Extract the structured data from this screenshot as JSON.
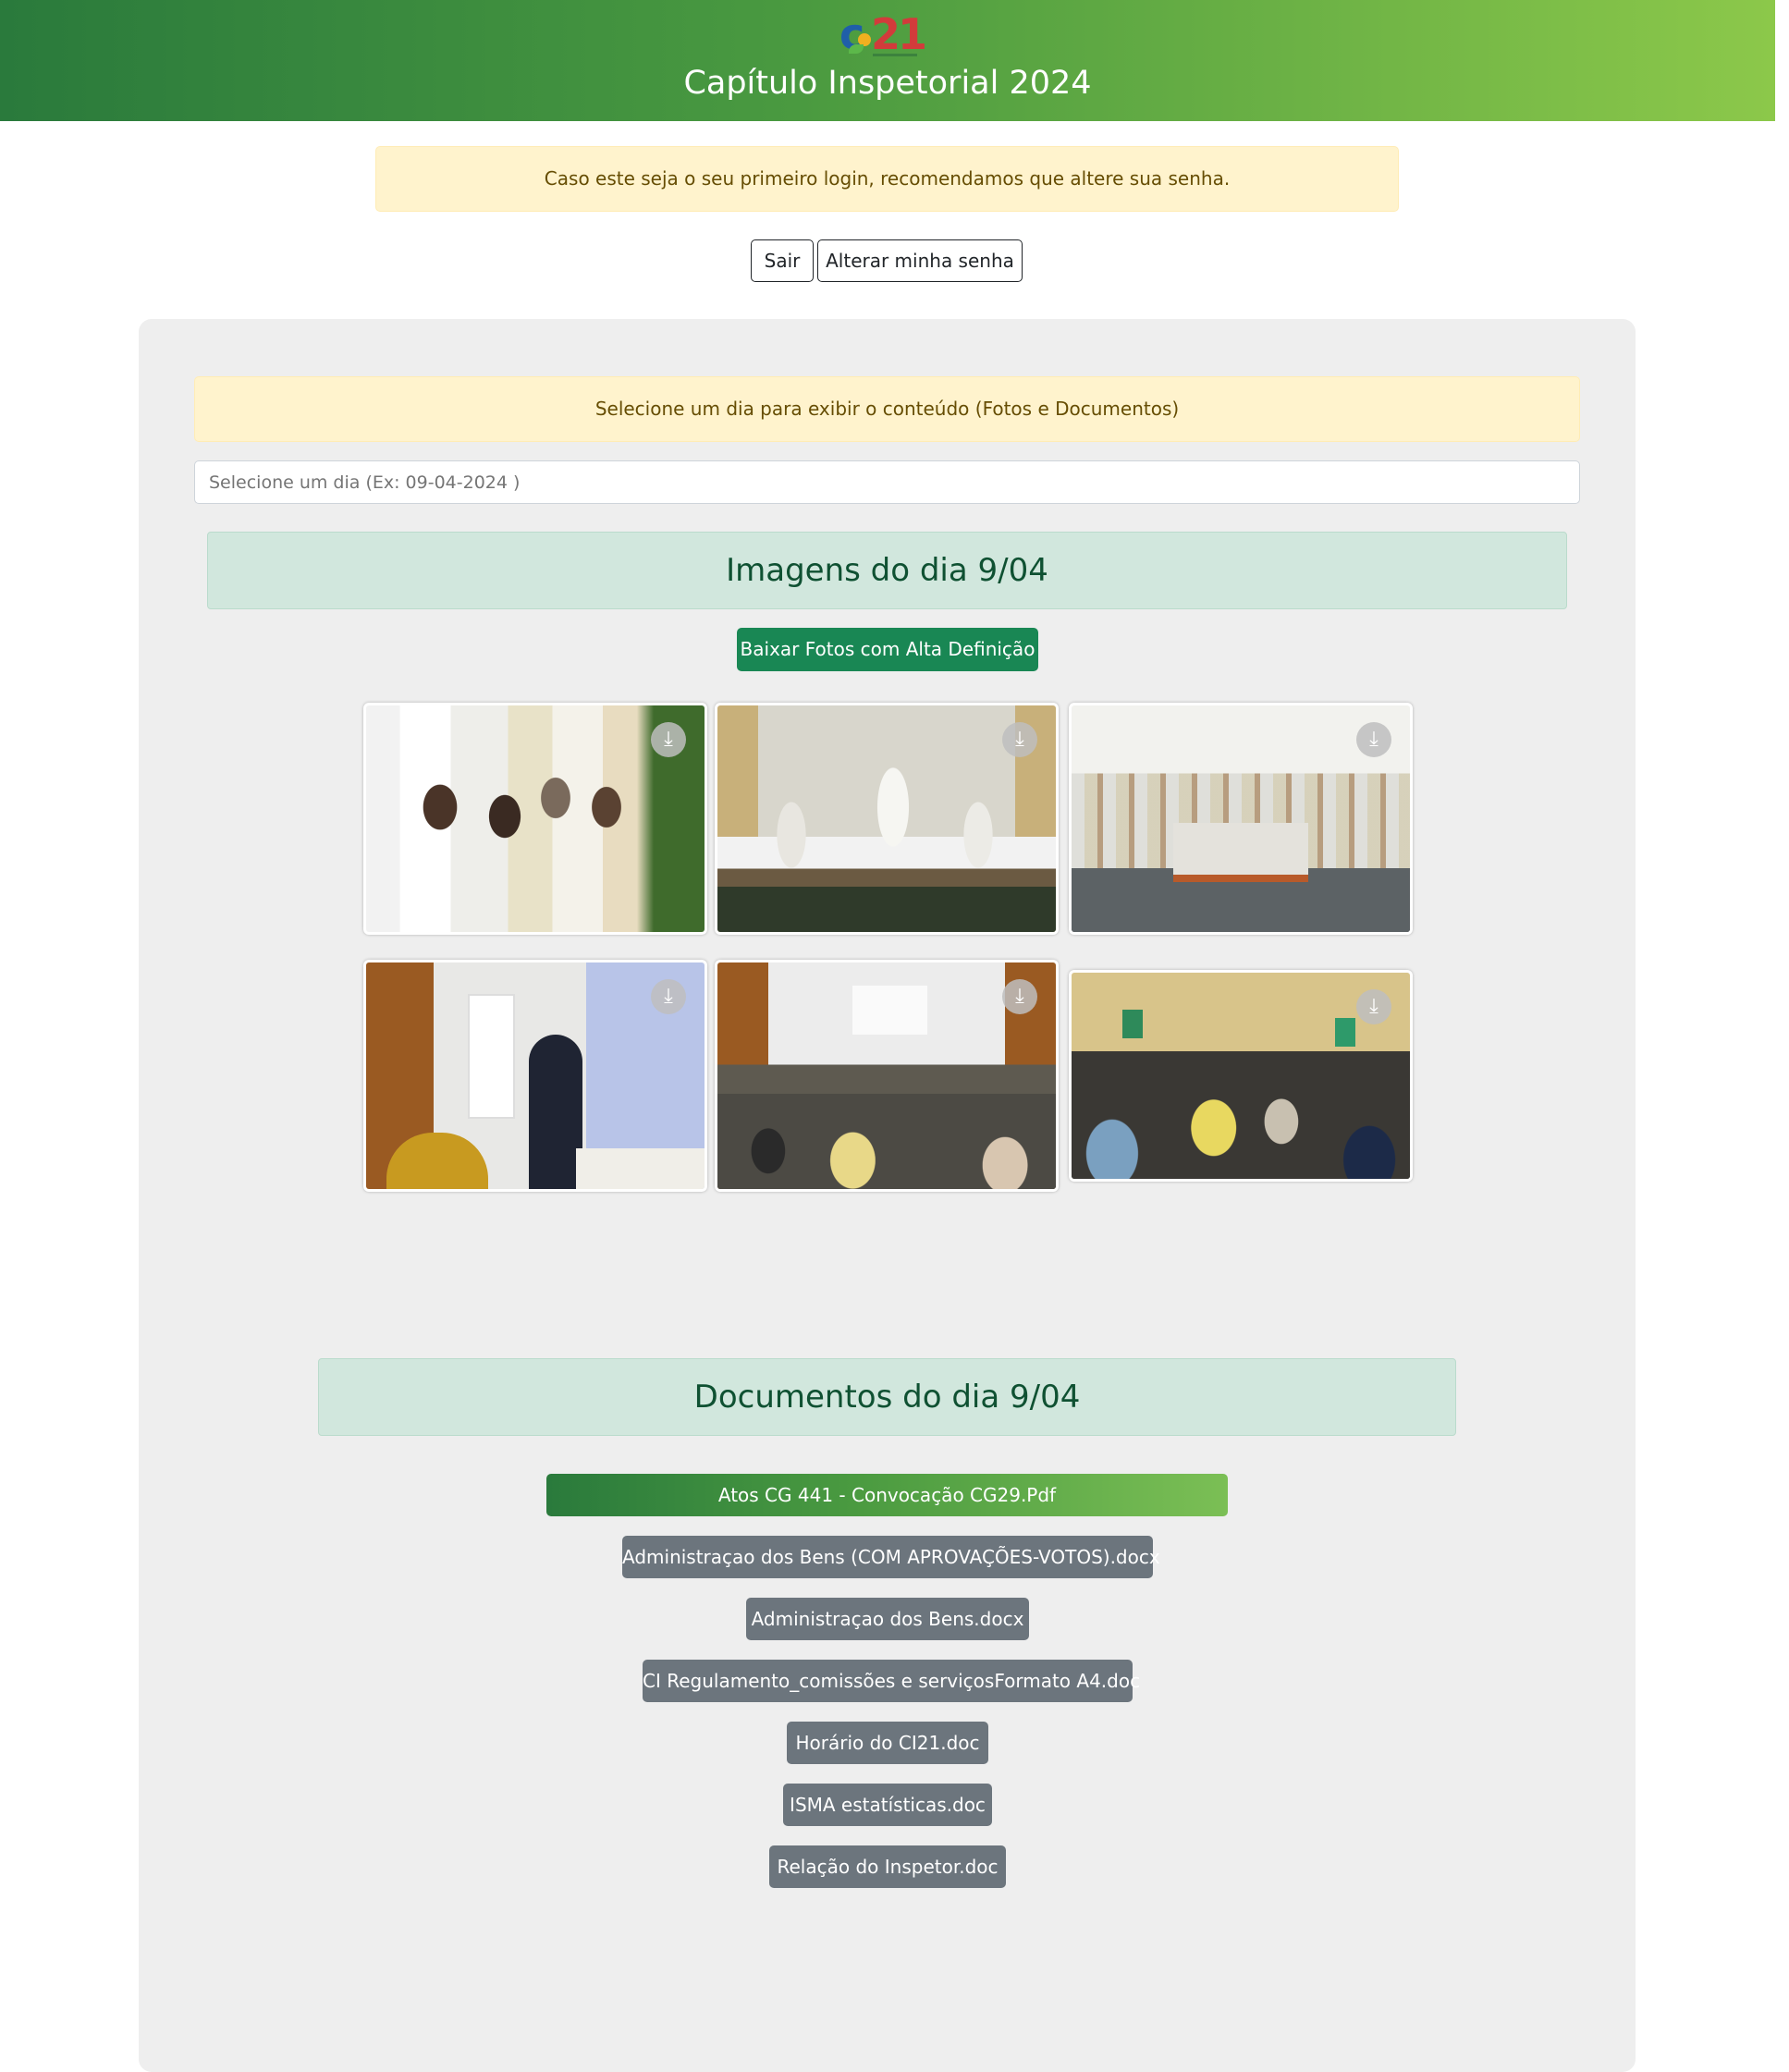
{
  "header": {
    "logo_text": "ci21",
    "title": "Capítulo Inspetorial 2024"
  },
  "notice": {
    "first_login": "Caso este seja o seu primeiro login, recomendamos que altere sua senha."
  },
  "actions": {
    "logout_label": "Sair",
    "change_password_label": "Alterar minha senha"
  },
  "content": {
    "select_day_alert": "Selecione um dia para exibir o conteúdo (Fotos e Documentos)",
    "date_input_placeholder": "Selecione um dia (Ex: 09-04-2024 )",
    "images_heading": "Imagens do dia 9/04",
    "download_hd_label": "Baixar Fotos com Alta Definição",
    "photos": [
      {
        "icon": "download-icon"
      },
      {
        "icon": "download-icon"
      },
      {
        "icon": "download-icon"
      },
      {
        "icon": "download-icon"
      },
      {
        "icon": "download-icon"
      },
      {
        "icon": "download-icon"
      }
    ],
    "documents_heading": "Documentos do dia 9/04",
    "documents": [
      "Atos CG 441 - Convocação CG29.Pdf",
      "Administraçao dos Bens (COM APROVAÇÕES-VOTOS).docx",
      "Administraçao dos Bens.docx",
      "CI Regulamento_comissões e serviçosFormato A4.doc",
      "Horário do CI21.doc",
      "ISMA estatísticas.doc",
      "Relação do Inspetor.doc"
    ]
  },
  "colors": {
    "header_start": "#2a7a3c",
    "header_end": "#8cc84a",
    "alert_bg": "#fff3cd",
    "success_heading_bg": "#d1e7dd",
    "success_button": "#198754",
    "secondary_button": "#6c757d",
    "panel_bg": "#eeeeee"
  }
}
